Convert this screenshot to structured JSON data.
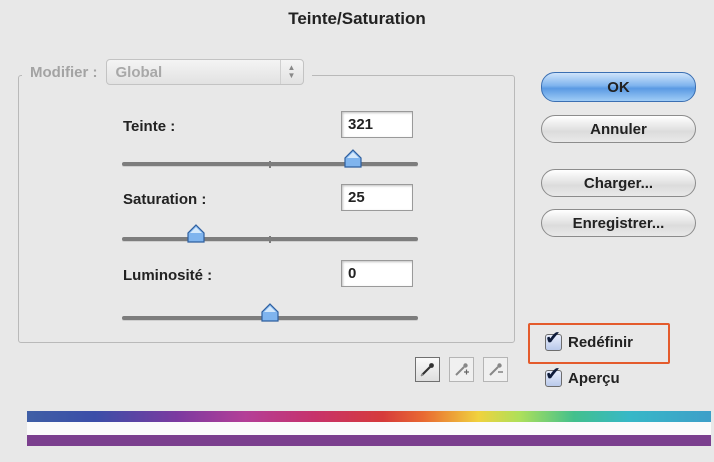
{
  "dialog": {
    "title": "Teinte/Saturation"
  },
  "modifier": {
    "label": "Modifier :",
    "value": "Global"
  },
  "hue": {
    "label": "Teinte :",
    "value": "321",
    "slider_fraction": 0.78
  },
  "saturation": {
    "label": "Saturation :",
    "value": "25",
    "slider_fraction": 0.25
  },
  "lightness": {
    "label": "Luminosité :",
    "value": "0",
    "slider_fraction": 0.5
  },
  "buttons": {
    "ok": "OK",
    "cancel": "Annuler",
    "load": "Charger...",
    "save": "Enregistrer..."
  },
  "options": {
    "colorize_label": "Redéfinir",
    "colorize_checked": true,
    "preview_label": "Aperçu",
    "preview_checked": true
  },
  "icons": [
    "eyedropper-icon",
    "eyedropper-plus-icon",
    "eyedropper-minus-icon"
  ],
  "colors": {
    "highlight": "#e45b2c",
    "default_button": "#7fb4ee",
    "bottom_band": "#7b3f8e"
  }
}
